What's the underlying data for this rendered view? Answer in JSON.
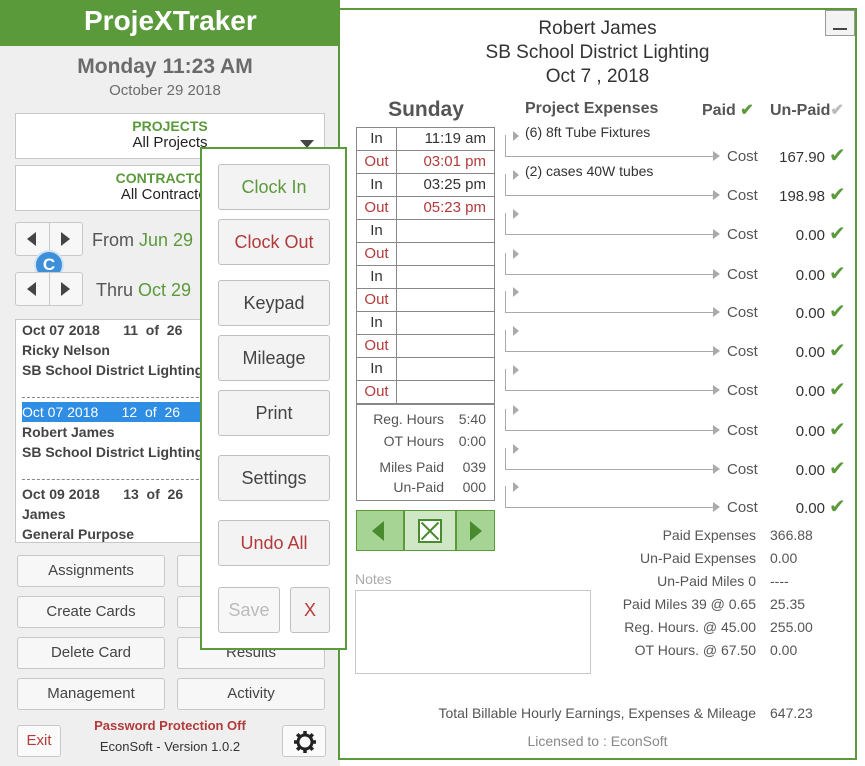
{
  "app": {
    "title": "ProjeXTraker"
  },
  "header": {
    "day_time": "Monday 11:23 AM",
    "date": "October 29 2018"
  },
  "filters": {
    "projects_title": "PROJECTS",
    "projects_value": "All Projects",
    "contractors_title": "CONTRACTORS",
    "contractors_value": "All Contractors"
  },
  "range": {
    "from_label": "From",
    "from_value": "Jun 29",
    "thru_label": "Thru",
    "thru_value": "Oct 29",
    "badge": "C"
  },
  "cards": [
    {
      "date": "Oct 07 2018",
      "index": "11",
      "of": "of",
      "total": "26",
      "name": "Ricky Nelson",
      "project": "SB School District Lighting",
      "selected": false
    },
    {
      "date": "Oct 07 2018",
      "index": "12",
      "of": "of",
      "total": "26",
      "name": "Robert James",
      "project": "SB School District Lighting",
      "selected": true
    },
    {
      "date": "Oct 09 2018",
      "index": "13",
      "of": "of",
      "total": "26",
      "name": "James",
      "project": "General Purpose",
      "selected": false
    }
  ],
  "buttons": {
    "assignments": "Assignments",
    "create_cards": "Create Cards",
    "delete_card": "Delete Card",
    "results": "Results",
    "management": "Management",
    "activity": "Activity",
    "exit": "Exit"
  },
  "footer": {
    "password_status": "Password Protection Off",
    "version": "EconSoft - Version 1.0.2"
  },
  "popup": {
    "clock_in": "Clock In",
    "clock_out": "Clock Out",
    "keypad": "Keypad",
    "mileage": "Mileage",
    "print": "Print",
    "settings": "Settings",
    "undo_all": "Undo All",
    "save": "Save",
    "close": "X"
  },
  "timecard": {
    "client": "Robert James",
    "project": "SB School District Lighting",
    "date": "Oct 7 , 2018",
    "day": "Sunday",
    "rows": [
      {
        "type": "In",
        "time": "11:19 am"
      },
      {
        "type": "Out",
        "time": "03:01 pm"
      },
      {
        "type": "In",
        "time": "03:25 pm"
      },
      {
        "type": "Out",
        "time": "05:23 pm"
      },
      {
        "type": "In",
        "time": ""
      },
      {
        "type": "Out",
        "time": ""
      },
      {
        "type": "In",
        "time": ""
      },
      {
        "type": "Out",
        "time": ""
      },
      {
        "type": "In",
        "time": ""
      },
      {
        "type": "Out",
        "time": ""
      },
      {
        "type": "In",
        "time": ""
      },
      {
        "type": "Out",
        "time": ""
      }
    ],
    "summary": {
      "reg_hours_label": "Reg. Hours",
      "reg_hours": "5:40",
      "ot_hours_label": "OT Hours",
      "ot_hours": "0:00",
      "miles_paid_label": "Miles Paid",
      "miles_paid": "039",
      "unpaid_label": "Un-Paid",
      "unpaid": "000"
    },
    "notes_label": "Notes"
  },
  "expenses": {
    "header": "Project Expenses",
    "paid_header": "Paid",
    "unpaid_header": "Un-Paid",
    "cost_label": "Cost",
    "items": [
      {
        "desc": "(6) 8ft Tube Fixtures",
        "cost": "167.90"
      },
      {
        "desc": "(2) cases 40W tubes",
        "cost": "198.98"
      },
      {
        "desc": "",
        "cost": "0.00"
      },
      {
        "desc": "",
        "cost": "0.00"
      },
      {
        "desc": "",
        "cost": "0.00"
      },
      {
        "desc": "",
        "cost": "0.00"
      },
      {
        "desc": "",
        "cost": "0.00"
      },
      {
        "desc": "",
        "cost": "0.00"
      },
      {
        "desc": "",
        "cost": "0.00"
      },
      {
        "desc": "",
        "cost": "0.00"
      }
    ]
  },
  "totals": [
    {
      "label": "Paid Expenses",
      "value": "366.88"
    },
    {
      "label": "Un-Paid Expenses",
      "value": "0.00"
    },
    {
      "label": "Un-Paid Miles 0",
      "value": "----"
    },
    {
      "label": "Paid Miles 39 @ 0.65",
      "value": "25.35"
    },
    {
      "label": "Reg. Hours. @ 45.00",
      "value": "255.00"
    },
    {
      "label": "OT Hours. @ 67.50",
      "value": "0.00"
    }
  ],
  "grand_total": {
    "label": "Total Billable Hourly Earnings, Expenses & Mileage",
    "value": "647.23"
  },
  "licensed": "Licensed to : EconSoft",
  "icons": {
    "check": "check-icon",
    "gear": "gear-icon",
    "stop": "stop-icon"
  },
  "colors": {
    "brand_green": "#5b9a3b",
    "out_red": "#b23a3a",
    "selection_blue": "#2f8de4"
  }
}
